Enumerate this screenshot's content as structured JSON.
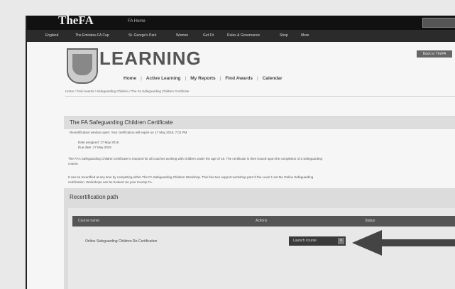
{
  "header": {
    "brand": "TheFA",
    "top_link": "FA Home",
    "nav_items": [
      "England",
      "The Emirates FA Cup",
      "St. George's Park",
      "Women",
      "Get Fit",
      "Rules & Governance",
      "Shop",
      "More"
    ]
  },
  "learning": {
    "title": "LEARNING",
    "top_right_button": "Back to TheFA",
    "subnav": [
      "Home",
      "Active Learning",
      "My Reports",
      "Find Awards",
      "Calendar"
    ],
    "breadcrumb": "Home / Find Awards / Safeguarding Children / The FA Safeguarding Children Certificate"
  },
  "certificate": {
    "title": "The FA Safeguarding Children Certificate",
    "recert_note": "Recertification window open: Your certification will expire on 17 May 2019, 7:01 PM",
    "date_assigned": "Date assigned: 17 May 2016",
    "due_date": "Due date: 17 May 2019",
    "para1_line1": "The FA's Safeguarding Children certificate is required for all coaches working with children under the age of 18. The certificate is then issued upon the completion of a Safeguarding",
    "para1_line2": "course.",
    "para2_line1": "It can be recertified at any time by completing either The FA Safeguarding Children Workshop. This free two support workshop part of the Level 1 set the Online Safeguarding",
    "para2_line2": "certification. Workshops can be booked via your County FA."
  },
  "recertification": {
    "heading": "Recertification path",
    "columns": [
      "Course name",
      "Actions",
      "Status"
    ],
    "rows": [
      {
        "name": "Online Safeguarding Children Re-Certification",
        "action": "Launch course"
      }
    ]
  },
  "colors": {
    "nav_bg": "#111111",
    "panel": "#dcdcdc",
    "table_head": "#555555",
    "arrow": "#444444"
  }
}
